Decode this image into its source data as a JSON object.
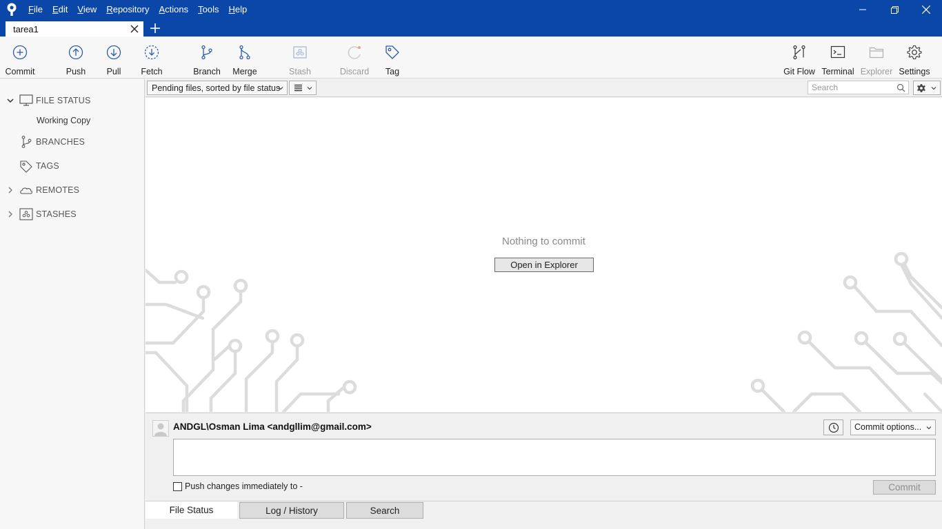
{
  "menu": {
    "items": [
      "File",
      "Edit",
      "View",
      "Repository",
      "Actions",
      "Tools",
      "Help"
    ]
  },
  "tabs": {
    "repo_name": "tarea1"
  },
  "toolbar": {
    "commit": "Commit",
    "push": "Push",
    "pull": "Pull",
    "fetch": "Fetch",
    "branch": "Branch",
    "merge": "Merge",
    "stash": "Stash",
    "discard": "Discard",
    "tag": "Tag",
    "git_flow": "Git Flow",
    "terminal": "Terminal",
    "explorer": "Explorer",
    "settings": "Settings"
  },
  "sidebar": {
    "file_status": "FILE STATUS",
    "working_copy": "Working Copy",
    "branches": "BRANCHES",
    "tags": "TAGS",
    "remotes": "REMOTES",
    "stashes": "STASHES"
  },
  "filterbar": {
    "sort_option": "Pending files, sorted by file status",
    "search_placeholder": "Search"
  },
  "main": {
    "empty_message": "Nothing to commit",
    "open_explorer": "Open in Explorer"
  },
  "commit": {
    "author": "ANDGL\\Osman Lima <andgllim@gmail.com>",
    "options_label": "Commit options...",
    "push_label": "Push changes immediately to -",
    "push_checked": false,
    "commit_button": "Commit"
  },
  "bottom_tabs": {
    "file_status": "File Status",
    "log_history": "Log / History",
    "search": "Search"
  },
  "colors": {
    "titlebar": "#0b47a8",
    "icon_blue": "#2a5da8",
    "disabled": "#9a9a9a"
  }
}
